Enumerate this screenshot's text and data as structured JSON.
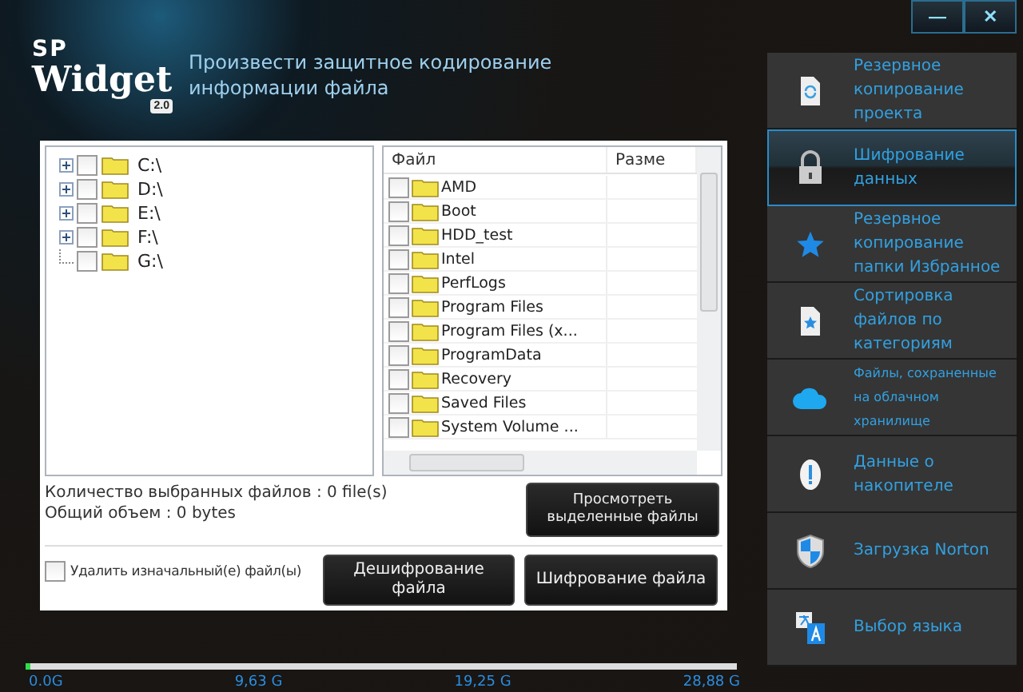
{
  "logo": {
    "brand": "SP",
    "product": "Widget",
    "version": "2.0"
  },
  "title": [
    "Произвести защитное кодирование",
    "информации файла"
  ],
  "window_controls": {
    "minimize": "—",
    "close": "✕"
  },
  "tree": [
    {
      "label": "C:\\",
      "has_children": true,
      "checked": false
    },
    {
      "label": "D:\\",
      "has_children": true,
      "checked": false
    },
    {
      "label": "E:\\",
      "has_children": true,
      "checked": false
    },
    {
      "label": "F:\\",
      "has_children": true,
      "checked": false
    },
    {
      "label": "G:\\",
      "has_children": false,
      "checked": false
    }
  ],
  "file_table": {
    "columns": [
      "Файл",
      "Разме"
    ],
    "rows": [
      {
        "name": "AMD",
        "checked": false
      },
      {
        "name": "Boot",
        "checked": false
      },
      {
        "name": "HDD_test",
        "checked": false
      },
      {
        "name": "Intel",
        "checked": false
      },
      {
        "name": "PerfLogs",
        "checked": false
      },
      {
        "name": "Program Files",
        "checked": false
      },
      {
        "name": "Program Files (x...",
        "checked": false
      },
      {
        "name": "ProgramData",
        "checked": false
      },
      {
        "name": "Recovery",
        "checked": false
      },
      {
        "name": "Saved Files",
        "checked": false
      },
      {
        "name": "System Volume ...",
        "checked": false
      }
    ]
  },
  "summary": [
    "Количество выбранных файлов : 0 file(s)",
    "Общий объем : 0 bytes"
  ],
  "view_button": "Просмотреть выделенные файлы",
  "delete_original": {
    "label": "Удалить изначальный(е) файл(ы)",
    "checked": false
  },
  "decrypt_button": "Дешифрование файла",
  "encrypt_button": "Шифрование файла",
  "capacity": {
    "level": 0.006,
    "ticks": [
      "0.0G",
      "9,63 G",
      "19,25 G",
      "28,88 G"
    ]
  },
  "sidebar": [
    {
      "kind": "doc-sync",
      "label": "Резервное копирование проекта",
      "selected": false
    },
    {
      "kind": "lock",
      "label": "Шифрование данных",
      "selected": true
    },
    {
      "kind": "star",
      "label": "Резервное копирование папки Избранное",
      "selected": false
    },
    {
      "kind": "doc-star",
      "label": "Сортировка файлов по категориям",
      "selected": false
    },
    {
      "kind": "cloud",
      "label": "Файлы, сохраненные на облачном хранилище",
      "selected": false,
      "small": true
    },
    {
      "kind": "info",
      "label": "Данные о накопителе",
      "selected": false
    },
    {
      "kind": "shield",
      "label": "Загрузка  Norton",
      "selected": false
    },
    {
      "kind": "lang",
      "label": "Выбор языка",
      "selected": false
    }
  ]
}
